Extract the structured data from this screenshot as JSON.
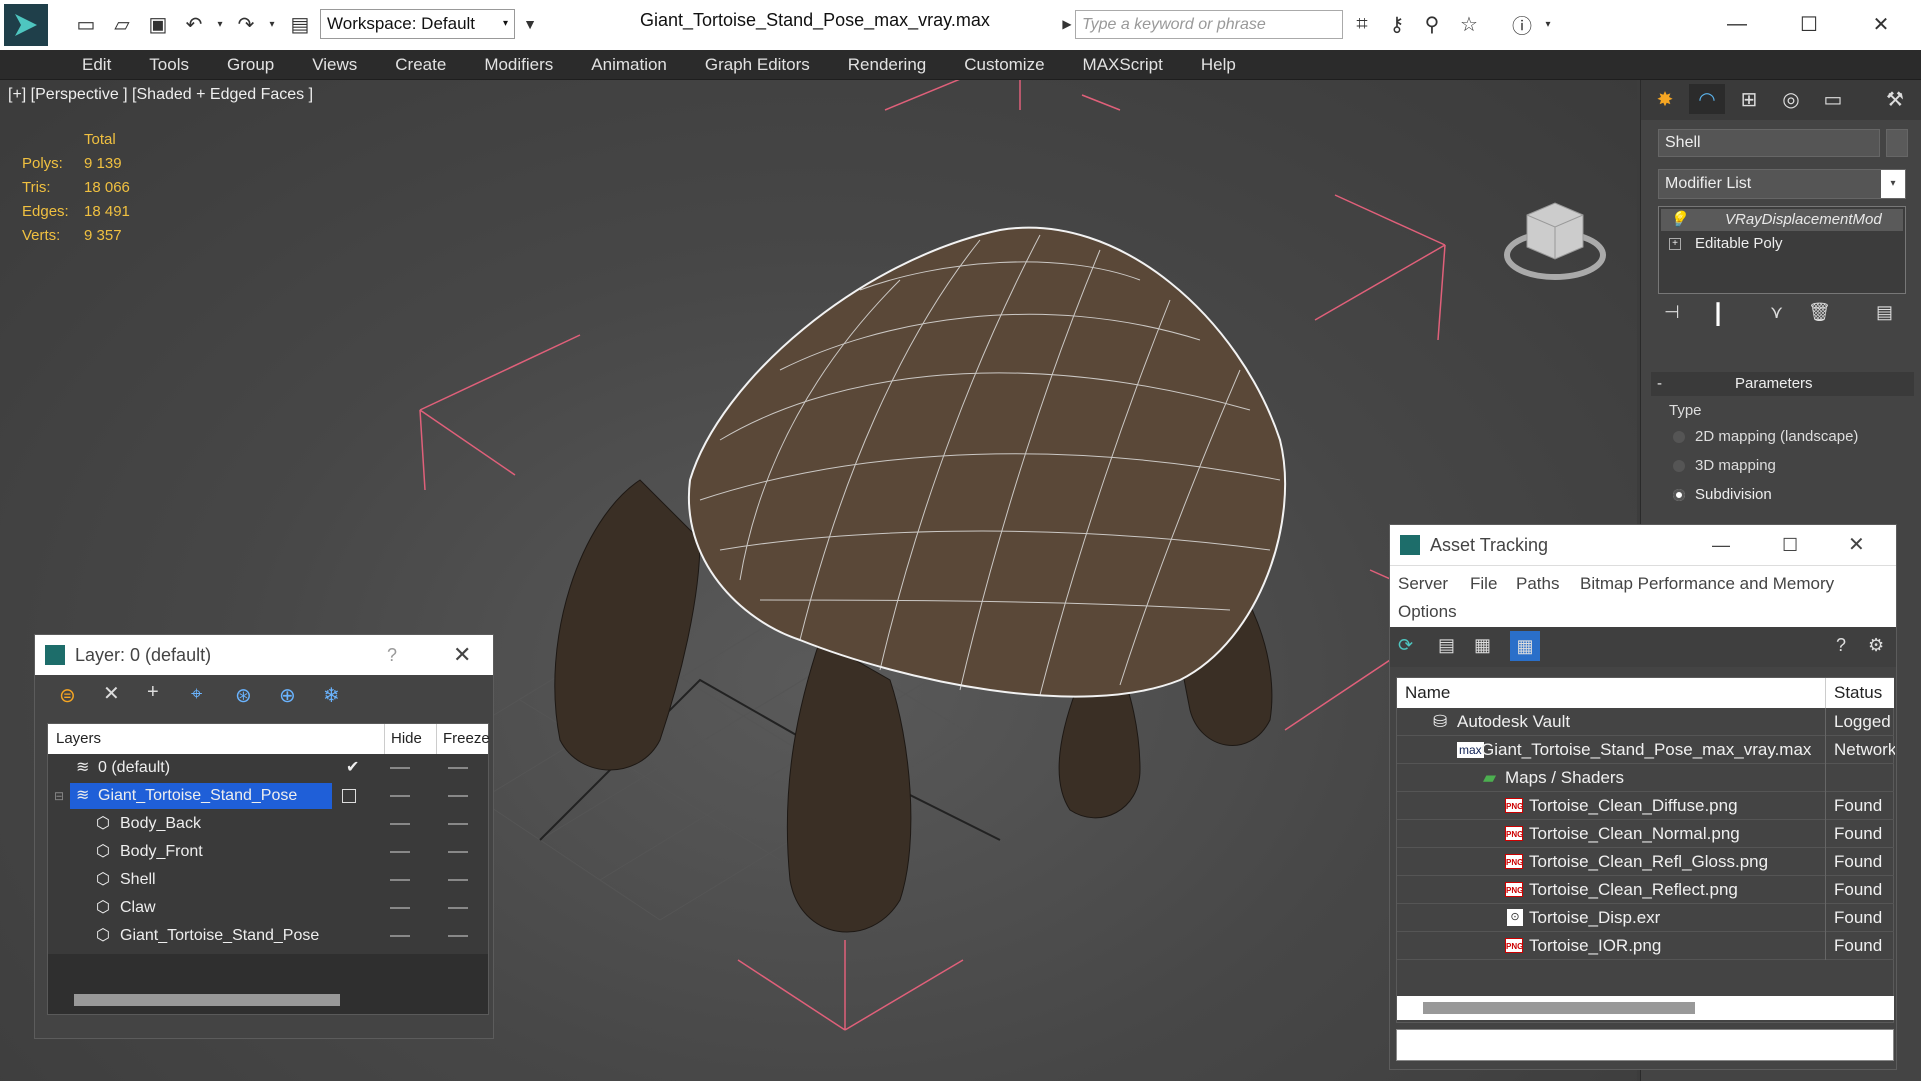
{
  "app": {
    "title": "Giant_Tortoise_Stand_Pose_max_vray.max",
    "workspace": "Workspace: Default",
    "search_placeholder": "Type a keyword or phrase",
    "icons": [
      "logo-icon",
      "new-icon",
      "open-icon",
      "save-icon",
      "undo-icon",
      "redo-icon",
      "project-icon",
      "search-binoculars-icon",
      "key-icon",
      "signin-icon",
      "star-icon",
      "help-icon",
      "minimize-icon",
      "maximize-icon",
      "close-icon"
    ]
  },
  "menu": [
    "Edit",
    "Tools",
    "Group",
    "Views",
    "Create",
    "Modifiers",
    "Animation",
    "Graph Editors",
    "Rendering",
    "Customize",
    "MAXScript",
    "Help"
  ],
  "viewport": {
    "label": "[+] [Perspective ] [Shaded + Edged Faces ]",
    "stats": {
      "header": "Total",
      "rows": [
        {
          "label": "Polys:",
          "value": "9 139"
        },
        {
          "label": "Tris:",
          "value": "18 066"
        },
        {
          "label": "Edges:",
          "value": "18 491"
        },
        {
          "label": "Verts:",
          "value": "9 357"
        }
      ]
    }
  },
  "command_panel": {
    "object_name": "Shell",
    "modifier_list": "Modifier List",
    "stack": [
      "VRayDisplacementMod",
      "Editable Poly"
    ],
    "parameters": {
      "title": "Parameters",
      "type_label": "Type",
      "options": [
        "2D mapping (landscape)",
        "3D mapping",
        "Subdivision"
      ],
      "selected": "Subdivision"
    }
  },
  "layer_window": {
    "title": "Layer: 0 (default)",
    "help": "?",
    "columns": [
      "Layers",
      "Hide",
      "Freeze"
    ],
    "rows": [
      {
        "name": "0 (default)",
        "level": 0
      },
      {
        "name": "Giant_Tortoise_Stand_Pose",
        "level": 0,
        "selected": true
      },
      {
        "name": "Body_Back",
        "level": 1
      },
      {
        "name": "Body_Front",
        "level": 1
      },
      {
        "name": "Shell",
        "level": 1
      },
      {
        "name": "Claw",
        "level": 1
      },
      {
        "name": "Giant_Tortoise_Stand_Pose",
        "level": 1
      }
    ]
  },
  "asset_window": {
    "title": "Asset Tracking",
    "menu": [
      "Server",
      "File",
      "Paths",
      "Bitmap Performance and Memory",
      "Options"
    ],
    "columns": [
      "Name",
      "Status"
    ],
    "rows": [
      {
        "name": "Autodesk Vault",
        "status": "Logged O",
        "icon": "vault-icon"
      },
      {
        "name": "Giant_Tortoise_Stand_Pose_max_vray.max",
        "status": "Network",
        "icon": "max-file-icon"
      },
      {
        "name": "Maps / Shaders",
        "status": "",
        "icon": "maps-icon"
      },
      {
        "name": "Tortoise_Clean_Diffuse.png",
        "status": "Found",
        "icon": "png-icon"
      },
      {
        "name": "Tortoise_Clean_Normal.png",
        "status": "Found",
        "icon": "png-icon"
      },
      {
        "name": "Tortoise_Clean_Refl_Gloss.png",
        "status": "Found",
        "icon": "png-icon"
      },
      {
        "name": "Tortoise_Clean_Reflect.png",
        "status": "Found",
        "icon": "png-icon"
      },
      {
        "name": "Tortoise_Disp.exr",
        "status": "Found",
        "icon": "exr-icon"
      },
      {
        "name": "Tortoise_IOR.png",
        "status": "Found",
        "icon": "png-icon"
      }
    ]
  },
  "colors": {
    "selection_blue": "#1f5fd8",
    "stat_yellow": "#f0c040",
    "bracket_pink": "#e0607a",
    "viewport_bg": "#474747"
  }
}
